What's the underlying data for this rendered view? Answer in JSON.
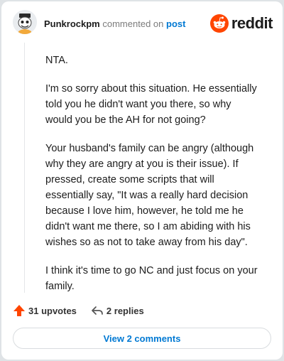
{
  "comment": {
    "username": "Punkrockpm",
    "action_text": "commented on",
    "post_link": "post",
    "paragraphs": [
      "NTA.",
      "I'm so sorry about this situation. He essentially told you he didn't want you there, so why would you be the AH for not going?",
      "Your husband's family can be angry (although why they are angry at you is their issue). If pressed, create some scripts that will essentially say, \"It was a really hard decision because I love him, however, he told me he didn't want me there, so I am abiding with his wishes so as not to take away from his day\".",
      "I think it's time to go NC and just focus on your family."
    ]
  },
  "brand": {
    "name": "reddit",
    "accent": "#ff4500"
  },
  "actions": {
    "upvotes": "31 upvotes",
    "replies": "2 replies"
  },
  "view_comments_label": "View 2 comments",
  "icons": [
    "avatar",
    "reddit-logo-icon",
    "upvote-arrow-icon",
    "reply-arrow-icon"
  ]
}
